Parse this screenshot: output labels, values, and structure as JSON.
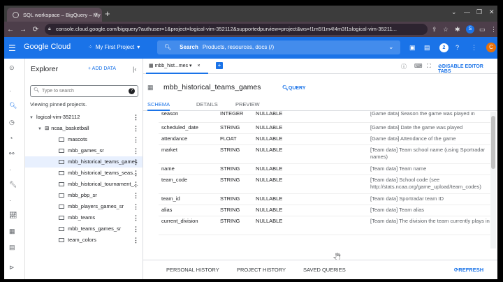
{
  "browser": {
    "tab_title": "SQL workspace – BigQuery – My",
    "tab_close": "×",
    "new_tab": "+",
    "url": "console.cloud.google.com/bigquery?authuser=1&project=logical-vim-352112&supportedpurview=project&ws=!1m5!1m4!4m3!1slogical-vim-35211...",
    "profile_initial": "S"
  },
  "header": {
    "logo": "Google Cloud",
    "project": "My First Project",
    "search_label": "Search",
    "search_hint": "Products, resources, docs (/)",
    "notifications_count": "2",
    "avatar_initial": "C",
    "accent": "#1a73e8"
  },
  "explorer": {
    "title": "Explorer",
    "add_data": "+ ADD DATA",
    "search_placeholder": "Type to search",
    "pinned_text": "Viewing pinned projects.",
    "project": "logical-vim-352112",
    "dataset": "ncaa_basketball",
    "tables": [
      "mascots",
      "mbb_games_sr",
      "mbb_historical_teams_games",
      "mbb_historical_teams_seas...",
      "mbb_historical_tournament_...",
      "mbb_pbp_sr",
      "mbb_players_games_sr",
      "mbb_teams",
      "mbb_teams_games_sr",
      "team_colors"
    ],
    "selected_table": "mbb_historical_teams_games"
  },
  "editor": {
    "tab_label": "mbb_hist...mes",
    "disable_tabs": "DISABLE EDITOR TABS",
    "table_title": "mbb_historical_teams_games",
    "query_button": "QUERY",
    "subtabs": [
      "SCHEMA",
      "DETAILS",
      "PREVIEW"
    ],
    "active_subtab": "SCHEMA",
    "schema": [
      {
        "name": "season",
        "type": "INTEGER",
        "mode": "NULLABLE",
        "desc": "[Game data] Season the game was played in"
      },
      {
        "name": "scheduled_date",
        "type": "STRING",
        "mode": "NULLABLE",
        "desc": "[Game data] Date the game was played"
      },
      {
        "name": "attendance",
        "type": "FLOAT",
        "mode": "NULLABLE",
        "desc": "[Game data] Attendance of the game"
      },
      {
        "name": "market",
        "type": "STRING",
        "mode": "NULLABLE",
        "desc": "[Team data] Team school name (using Sportradar names)"
      },
      {
        "name": "name",
        "type": "STRING",
        "mode": "NULLABLE",
        "desc": "[Team data] Team name"
      },
      {
        "name": "team_code",
        "type": "STRING",
        "mode": "NULLABLE",
        "desc": "[Team data] School code (see http://stats.ncaa.org/game_upload/team_codes)"
      },
      {
        "name": "team_id",
        "type": "STRING",
        "mode": "NULLABLE",
        "desc": "[Team data] Sportradar team ID"
      },
      {
        "name": "alias",
        "type": "STRING",
        "mode": "NULLABLE",
        "desc": "[Team data] Team alias"
      },
      {
        "name": "current_division",
        "type": "STRING",
        "mode": "NULLABLE",
        "desc": "[Team data] The division the team currently plays in"
      }
    ]
  },
  "bottom": {
    "personal_history": "PERSONAL HISTORY",
    "project_history": "PROJECT HISTORY",
    "saved_queries": "SAVED QUERIES",
    "refresh": "REFRESH"
  }
}
